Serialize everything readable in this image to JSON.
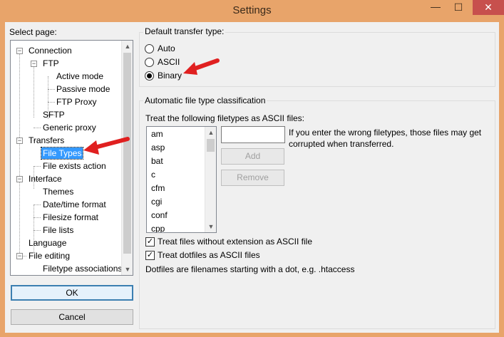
{
  "window": {
    "title": "Settings",
    "minimize": "—",
    "maximize": "☐",
    "close": "✕"
  },
  "select_page_label": "Select page:",
  "tree": {
    "items": [
      {
        "label": "Connection",
        "expanded": true
      },
      {
        "label": "FTP",
        "expanded": true
      },
      {
        "label": "Active mode"
      },
      {
        "label": "Passive mode"
      },
      {
        "label": "FTP Proxy"
      },
      {
        "label": "SFTP"
      },
      {
        "label": "Generic proxy"
      },
      {
        "label": "Transfers",
        "expanded": true
      },
      {
        "label": "File Types",
        "selected": true
      },
      {
        "label": "File exists action"
      },
      {
        "label": "Interface",
        "expanded": true
      },
      {
        "label": "Themes"
      },
      {
        "label": "Date/time format"
      },
      {
        "label": "Filesize format"
      },
      {
        "label": "File lists"
      },
      {
        "label": "Language"
      },
      {
        "label": "File editing",
        "expanded": true
      },
      {
        "label": "Filetype associations"
      }
    ]
  },
  "buttons": {
    "ok": "OK",
    "cancel": "Cancel",
    "add": "Add",
    "remove": "Remove"
  },
  "default_transfer": {
    "title": "Default transfer type:",
    "options": [
      "Auto",
      "ASCII",
      "Binary"
    ],
    "selected": "Binary"
  },
  "auto_classification": {
    "title": "Automatic file type classification",
    "treat_label": "Treat the following filetypes as ASCII files:",
    "filetypes": [
      "am",
      "asp",
      "bat",
      "c",
      "cfm",
      "cgi",
      "conf",
      "cpp"
    ],
    "new_filetype_value": "",
    "note": "If you enter the wrong filetypes, those files may get corrupted when transferred.",
    "checkbox_no_extension": "Treat files without extension as ASCII file",
    "checkbox_no_extension_checked": true,
    "checkbox_dotfiles": "Treat dotfiles as ASCII files",
    "checkbox_dotfiles_checked": true,
    "dotfiles_note": "Dotfiles are filenames starting with a dot, e.g. .htaccess"
  },
  "colors": {
    "titlebar": "#e8a46a",
    "close_button": "#c7504d",
    "selection": "#3399ff",
    "arrow": "#e02020"
  }
}
